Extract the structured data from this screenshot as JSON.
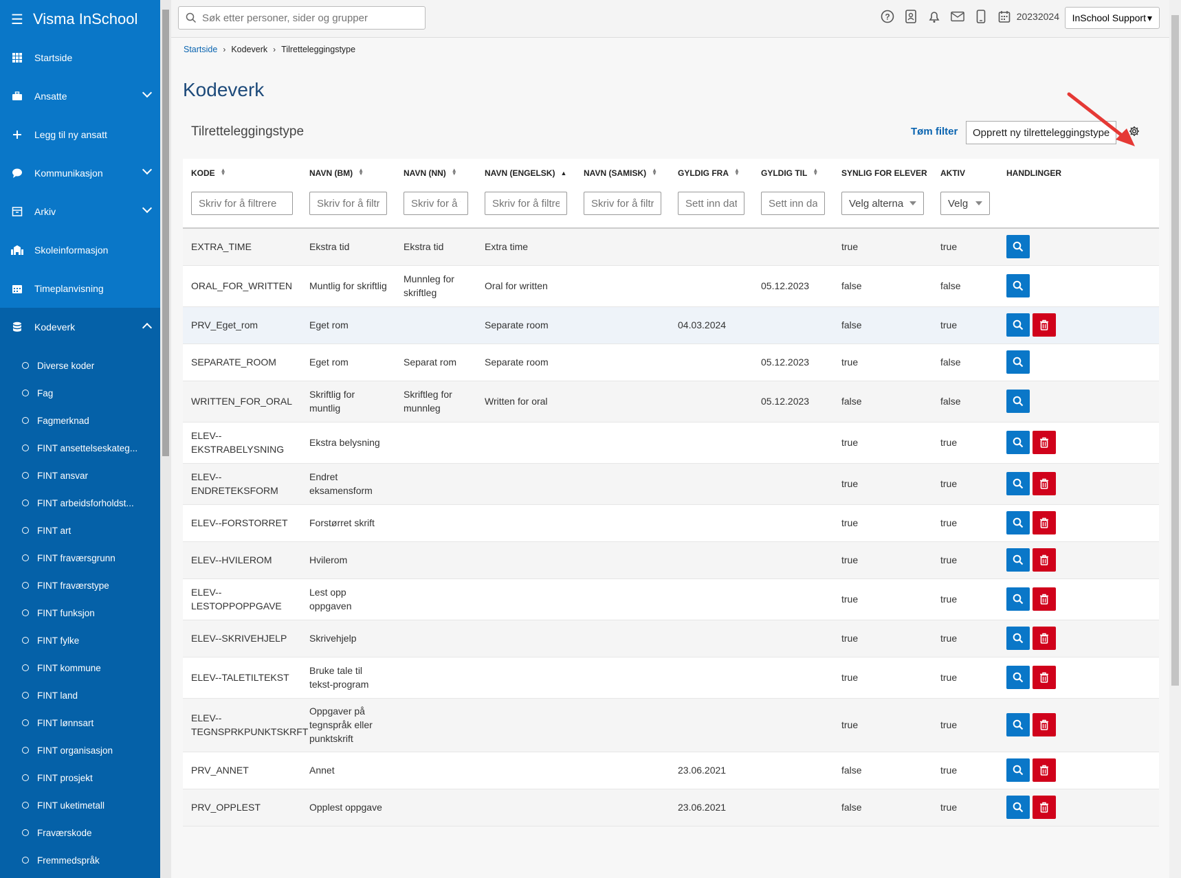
{
  "app": {
    "title": "Visma InSchool"
  },
  "sidebar": {
    "items": [
      {
        "label": "Startside",
        "icon": "grid-icon"
      },
      {
        "label": "Ansatte",
        "icon": "briefcase-icon"
      },
      {
        "label": "Legg til ny ansatt",
        "icon": "plus-icon"
      },
      {
        "label": "Kommunikasjon",
        "icon": "chat-icon"
      },
      {
        "label": "Arkiv",
        "icon": "archive-icon"
      },
      {
        "label": "Skoleinformasjon",
        "icon": "school-icon"
      },
      {
        "label": "Timeplanvisning",
        "icon": "calendar-icon"
      },
      {
        "label": "Kodeverk",
        "icon": "database-icon"
      }
    ],
    "subitems": [
      "Diverse koder",
      "Fag",
      "Fagmerknad",
      "FINT ansettelseskateg...",
      "FINT ansvar",
      "FINT arbeidsforholdst...",
      "FINT art",
      "FINT fraværsgrunn",
      "FINT fraværstype",
      "FINT funksjon",
      "FINT fylke",
      "FINT kommune",
      "FINT land",
      "FINT lønnsart",
      "FINT organisasjon",
      "FINT prosjekt",
      "FINT uketimetall",
      "Fraværskode",
      "Fremmedspråk"
    ]
  },
  "topbar": {
    "search_placeholder": "Søk etter personer, sider og grupper",
    "school_year": "20232024",
    "user_button": "InSchool Support"
  },
  "breadcrumb": {
    "home": "Startside",
    "level2": "Kodeverk",
    "current": "Tilretteleggingstype"
  },
  "page": {
    "title": "Kodeverk",
    "section_title": "Tilretteleggingstype",
    "clear_filter": "Tøm filter",
    "create_button": "Opprett ny tilretteleggingstype"
  },
  "table": {
    "columns": [
      "KODE",
      "NAVN (BM)",
      "NAVN (NN)",
      "NAVN (ENGELSK)",
      "NAVN (SAMISK)",
      "GYLDIG FRA",
      "GYLDIG TIL",
      "SYNLIG FOR ELEVER",
      "AKTIV",
      "HANDLINGER"
    ],
    "sort_active_column": "NAVN (ENGELSK)",
    "filters": {
      "text_placeholder": "Skriv for å filtrere",
      "date_placeholder": "Sett inn dato",
      "select_visible": "Velg alterna",
      "select_short": "Velg"
    },
    "rows": [
      {
        "kode": "EXTRA_TIME",
        "bm": "Ekstra tid",
        "nn": "Ekstra tid",
        "en": "Extra time",
        "se": "",
        "fra": "",
        "til": "",
        "synlig": "true",
        "aktiv": "true",
        "delete": false
      },
      {
        "kode": "ORAL_FOR_WRITTEN",
        "bm": "Muntlig for skriftlig",
        "nn": "Munnleg for skriftleg",
        "en": "Oral for written",
        "se": "",
        "fra": "",
        "til": "05.12.2023",
        "synlig": "false",
        "aktiv": "false",
        "delete": false
      },
      {
        "kode": "PRV_Eget_rom",
        "bm": "Eget rom",
        "nn": "",
        "en": "Separate room",
        "se": "",
        "fra": "04.03.2024",
        "til": "",
        "synlig": "false",
        "aktiv": "true",
        "delete": true
      },
      {
        "kode": "SEPARATE_ROOM",
        "bm": "Eget rom",
        "nn": "Separat rom",
        "en": "Separate room",
        "se": "",
        "fra": "",
        "til": "05.12.2023",
        "synlig": "true",
        "aktiv": "false",
        "delete": false
      },
      {
        "kode": "WRITTEN_FOR_ORAL",
        "bm": "Skriftlig for muntlig",
        "nn": "Skriftleg for munnleg",
        "en": "Written for oral",
        "se": "",
        "fra": "",
        "til": "05.12.2023",
        "synlig": "false",
        "aktiv": "false",
        "delete": false
      },
      {
        "kode": "ELEV--EKSTRABELYSNING",
        "bm": "Ekstra belysning",
        "nn": "",
        "en": "",
        "se": "",
        "fra": "",
        "til": "",
        "synlig": "true",
        "aktiv": "true",
        "delete": true
      },
      {
        "kode": "ELEV--ENDRETEKSFORM",
        "bm": "Endret eksamensform",
        "nn": "",
        "en": "",
        "se": "",
        "fra": "",
        "til": "",
        "synlig": "true",
        "aktiv": "true",
        "delete": true
      },
      {
        "kode": "ELEV--FORSTORRET",
        "bm": "Forstørret skrift",
        "nn": "",
        "en": "",
        "se": "",
        "fra": "",
        "til": "",
        "synlig": "true",
        "aktiv": "true",
        "delete": true
      },
      {
        "kode": "ELEV--HVILEROM",
        "bm": "Hvilerom",
        "nn": "",
        "en": "",
        "se": "",
        "fra": "",
        "til": "",
        "synlig": "true",
        "aktiv": "true",
        "delete": true
      },
      {
        "kode": "ELEV--LESTOPPOPPGAVE",
        "bm": "Lest opp oppgaven",
        "nn": "",
        "en": "",
        "se": "",
        "fra": "",
        "til": "",
        "synlig": "true",
        "aktiv": "true",
        "delete": true
      },
      {
        "kode": "ELEV--SKRIVEHJELP",
        "bm": "Skrivehjelp",
        "nn": "",
        "en": "",
        "se": "",
        "fra": "",
        "til": "",
        "synlig": "true",
        "aktiv": "true",
        "delete": true
      },
      {
        "kode": "ELEV--TALETILTEKST",
        "bm": "Bruke tale til tekst-program",
        "nn": "",
        "en": "",
        "se": "",
        "fra": "",
        "til": "",
        "synlig": "true",
        "aktiv": "true",
        "delete": true
      },
      {
        "kode": "ELEV--TEGNSPRKPUNKTSKRFT",
        "bm": "Oppgaver på tegnspråk eller punktskrift",
        "nn": "",
        "en": "",
        "se": "",
        "fra": "",
        "til": "",
        "synlig": "true",
        "aktiv": "true",
        "delete": true
      },
      {
        "kode": "PRV_ANNET",
        "bm": "Annet",
        "nn": "",
        "en": "",
        "se": "",
        "fra": "23.06.2021",
        "til": "",
        "synlig": "false",
        "aktiv": "true",
        "delete": true
      },
      {
        "kode": "PRV_OPPLEST",
        "bm": "Opplest oppgave",
        "nn": "",
        "en": "",
        "se": "",
        "fra": "23.06.2021",
        "til": "",
        "synlig": "false",
        "aktiv": "true",
        "delete": true
      }
    ]
  },
  "colors": {
    "brand": "#0a77c8",
    "sidebar_sub": "#0561a8",
    "danger": "#d0021b",
    "arrow": "#e53935"
  }
}
